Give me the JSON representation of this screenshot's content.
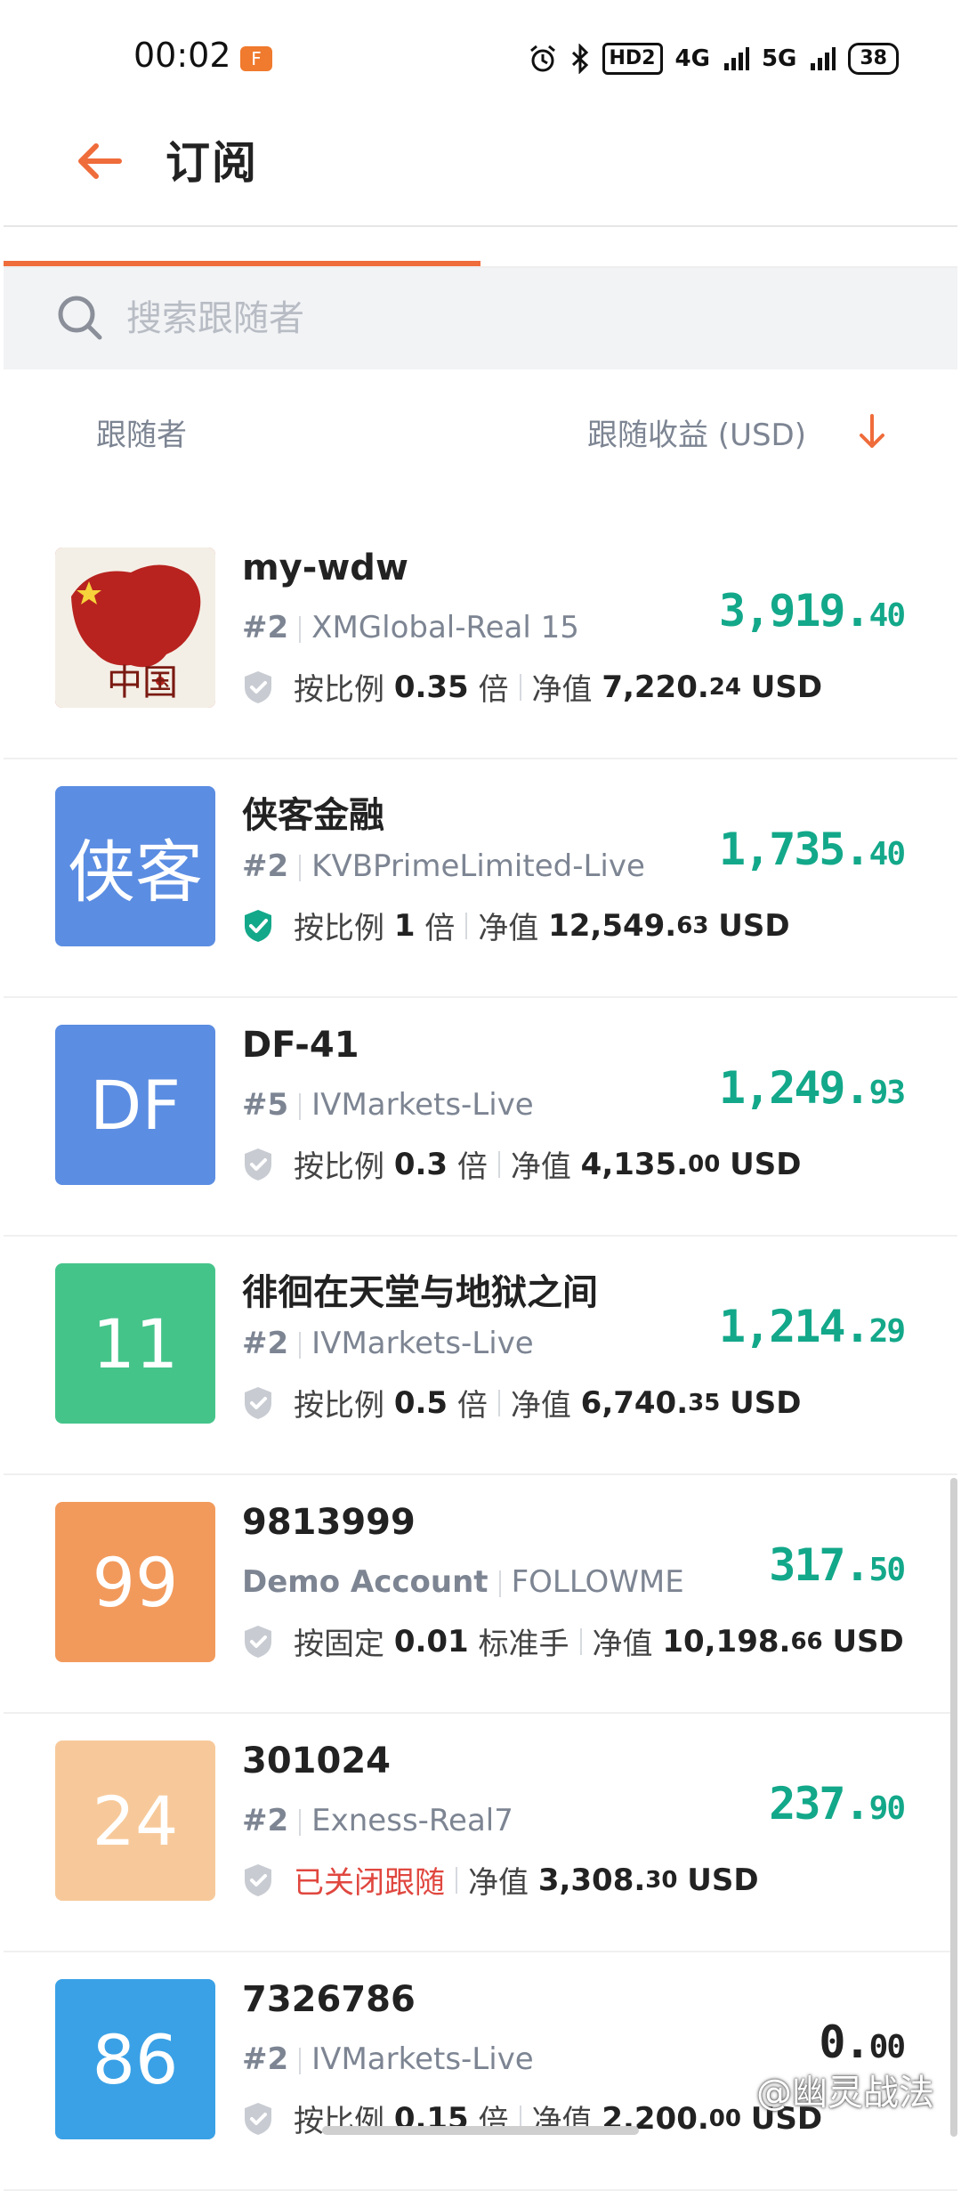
{
  "status_bar": {
    "time": "00:02",
    "indicators": [
      "HD2",
      "4G",
      "5G"
    ],
    "battery": "38"
  },
  "header": {
    "title": "订阅"
  },
  "search": {
    "placeholder": "搜索跟随者"
  },
  "columns": {
    "left": "跟随者",
    "right": "跟随收益 (USD)"
  },
  "labels": {
    "net_value": "净值",
    "usd": "USD"
  },
  "colors": {
    "accent": "#ef6c3b",
    "profit": "#13a88a",
    "closed": "#e0473f",
    "verified": "#13a88a"
  },
  "followers": [
    {
      "name": "my-wdw",
      "rank": "#2",
      "server": "XMGlobal-Real 15",
      "mode_prefix": "按比例",
      "mode_value": "0.35",
      "mode_suffix": "倍",
      "equity_int": "7,220.",
      "equity_dec": "24",
      "profit_int": "3,919.",
      "profit_dec": "40",
      "avatar_text": "",
      "avatar_color": "#c8332a",
      "verified": false
    },
    {
      "name": "侠客金融",
      "rank": "#2",
      "server": "KVBPrimeLimited-Live",
      "mode_prefix": "按比例",
      "mode_value": "1",
      "mode_suffix": "倍",
      "equity_int": "12,549.",
      "equity_dec": "63",
      "profit_int": "1,735.",
      "profit_dec": "40",
      "avatar_text": "侠客",
      "avatar_color": "#5b8de2",
      "verified": true
    },
    {
      "name": "DF-41",
      "rank": "#5",
      "server": "IVMarkets-Live",
      "mode_prefix": "按比例",
      "mode_value": "0.3",
      "mode_suffix": "倍",
      "equity_int": "4,135.",
      "equity_dec": "00",
      "profit_int": "1,249.",
      "profit_dec": "93",
      "avatar_text": "DF",
      "avatar_color": "#5b8de2",
      "verified": false
    },
    {
      "name": "徘徊在天堂与地狱之间",
      "rank": "#2",
      "server": "IVMarkets-Live",
      "mode_prefix": "按比例",
      "mode_value": "0.5",
      "mode_suffix": "倍",
      "equity_int": "6,740.",
      "equity_dec": "35",
      "profit_int": "1,214.",
      "profit_dec": "29",
      "avatar_text": "11",
      "avatar_color": "#45c48a",
      "verified": false
    },
    {
      "name": "9813999",
      "rank": "Demo Account",
      "server": "FOLLOWME",
      "mode_prefix": "按固定",
      "mode_value": "0.01",
      "mode_suffix": "标准手",
      "equity_int": "10,198.",
      "equity_dec": "66",
      "profit_int": "317.",
      "profit_dec": "50",
      "avatar_text": "99",
      "avatar_color": "#f29a5c",
      "verified": false
    },
    {
      "name": "301024",
      "rank": "#2",
      "server": "Exness-Real7",
      "mode_prefix": "已关闭跟随",
      "mode_value": "",
      "mode_suffix": "",
      "equity_int": "3,308.",
      "equity_dec": "30",
      "profit_int": "237.",
      "profit_dec": "90",
      "avatar_text": "24",
      "avatar_color": "#f7c99a",
      "verified": false,
      "closed": true
    },
    {
      "name": "7326786",
      "rank": "#2",
      "server": "IVMarkets-Live",
      "mode_prefix": "按比例",
      "mode_value": "0.15",
      "mode_suffix": "倍",
      "equity_int": "2,200.",
      "equity_dec": "00",
      "profit_int": "0.",
      "profit_dec": "00",
      "avatar_text": "86",
      "avatar_color": "#3aa1e6",
      "verified": false
    }
  ],
  "watermark": "@幽灵战法"
}
